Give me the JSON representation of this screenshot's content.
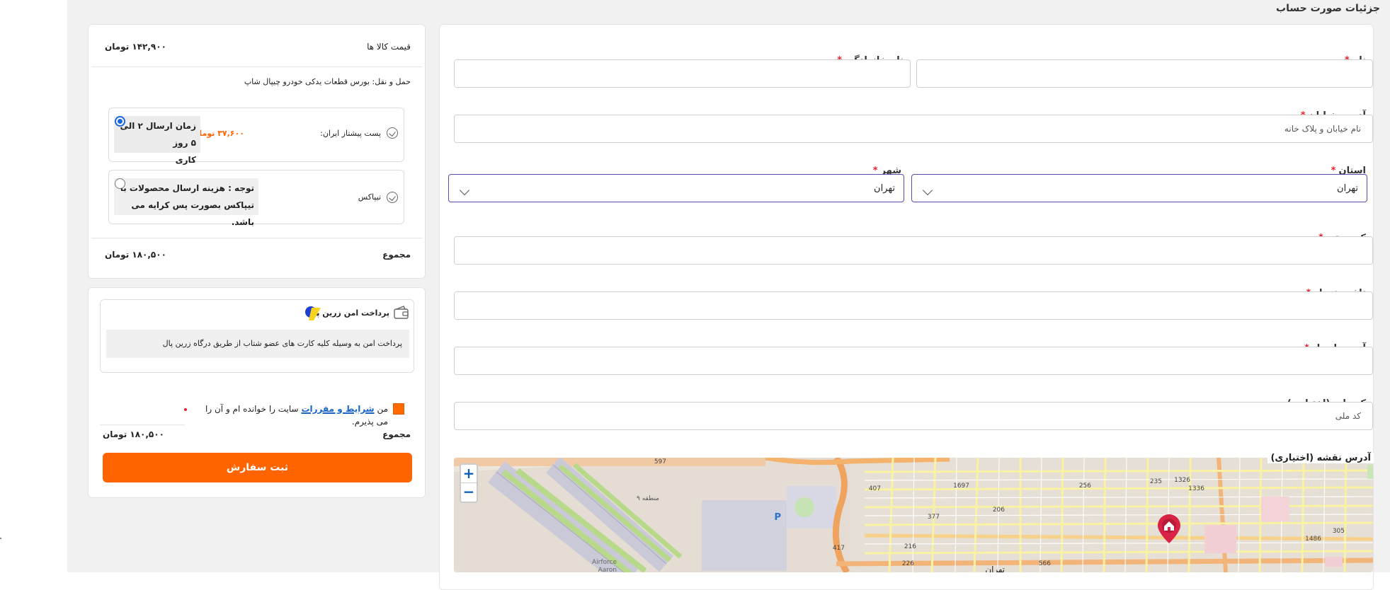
{
  "page": {
    "title": "جزئیات صورت حساب"
  },
  "form": {
    "first_name": {
      "label": "نام",
      "value": ""
    },
    "last_name": {
      "label": "نام خانوادگی",
      "value": ""
    },
    "street": {
      "label": "آدرس خیابان",
      "placeholder": "نام خیابان و پلاک خانه"
    },
    "province": {
      "label": "استان",
      "selected": "تهران"
    },
    "city": {
      "label": "شهر",
      "selected": "تهران"
    },
    "postal": {
      "label": "کد پستی",
      "value": ""
    },
    "mobile": {
      "label": "تلفن همراه",
      "value": ""
    },
    "email": {
      "label": "آدرس ایمیل",
      "value": ""
    },
    "national_id": {
      "label": "کد ملی (اختیاری)",
      "placeholder": "کد ملی"
    },
    "map_label": "آدرس نقشه (اختیاری)",
    "required_mark": "*"
  },
  "map": {
    "zoom_in": "+",
    "zoom_out": "−",
    "labels": [
      "تهران",
      "منطقه ۹",
      "Airforce",
      "Aaron",
      "P",
      "1697",
      "1326",
      "1336",
      "256",
      "235",
      "407",
      "377",
      "206",
      "216",
      "417",
      "226",
      "566",
      "305",
      "1486",
      "597"
    ]
  },
  "summary": {
    "items_label": "قیمت کالا ها",
    "items_price": "۱۴۲,۹۰۰ تومان",
    "shipping_label": "حمل و نقل: بورس قطعات یدکی خودرو چیپال شاپ",
    "option1_name": "پست پیشتاز ایران:",
    "option1_price": "۳۷,۶۰۰ تومان",
    "option1_note_line1": "زمان ارسال ۲ الی ۵ روز",
    "option1_note_line2": "کاری",
    "option2_name": "تیپاکس",
    "option2_note_line1": "توجه : هزینه ارسال محصولات با",
    "option2_note_line2": "تیپاکس بصورت پس کرایه می باشد.",
    "total_label": "مجموع",
    "total_value": "۱۸۰,۵۰۰ تومان"
  },
  "payment": {
    "gateway_title": "پرداخت امن زرین پال",
    "gateway_desc": "پرداخت امن به وسیله کلیه کارت های عضو شتاب از طریق درگاه زرین پال",
    "terms_prefix": "من",
    "terms_link": "شرایط و مقررات",
    "terms_suffix": "سایت را خوانده ام و آن را",
    "terms_line2": "می پذیرم.",
    "total_label": "مجموع",
    "total_value": "۱۸۰,۵۰۰ تومان",
    "submit_label": "ثبت سفارش"
  },
  "colors": {
    "accent": "#ff6400",
    "link": "#1a66c8",
    "required": "#e4232f",
    "select_border": "#5b4bb5"
  }
}
